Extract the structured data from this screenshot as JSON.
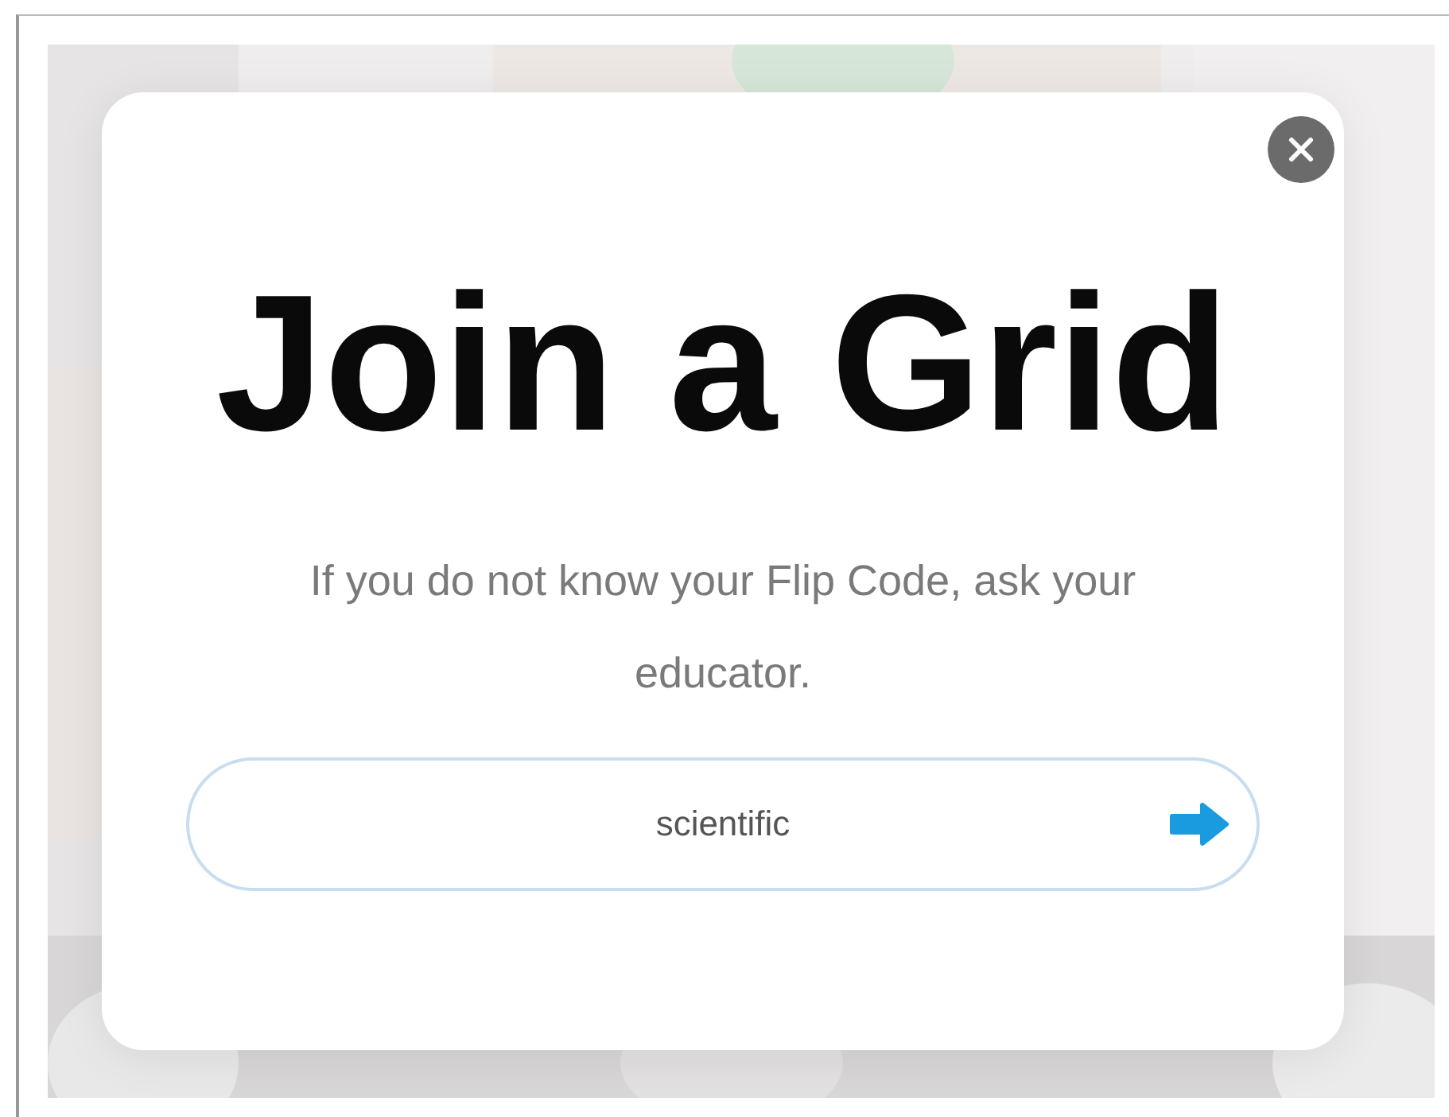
{
  "dialog": {
    "title": "Join a Grid",
    "message": "If you do not know your Flip Code, ask your educator.",
    "code_field": {
      "value": "scientific"
    }
  }
}
